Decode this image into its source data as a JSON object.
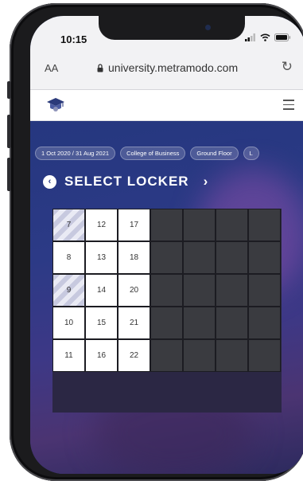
{
  "status_bar": {
    "time": "10:15"
  },
  "browser": {
    "text_size_label": "AA",
    "url": "university.metramodo.com"
  },
  "filters": [
    {
      "label": "1 Oct 2020 / 31 Aug 2021"
    },
    {
      "label": "College of Business"
    },
    {
      "label": "Ground Floor"
    },
    {
      "label": "L"
    }
  ],
  "page": {
    "title": "SELECT LOCKER"
  },
  "locker_grid": {
    "rows": [
      [
        {
          "label": "7",
          "state": "striped"
        },
        {
          "label": "12",
          "state": "available"
        },
        {
          "label": "17",
          "state": "available"
        },
        {
          "label": "",
          "state": "unavailable"
        },
        {
          "label": "",
          "state": "unavailable"
        },
        {
          "label": "",
          "state": "unavailable"
        },
        {
          "label": "",
          "state": "unavailable"
        }
      ],
      [
        {
          "label": "8",
          "state": "available"
        },
        {
          "label": "13",
          "state": "available"
        },
        {
          "label": "18",
          "state": "available"
        },
        {
          "label": "",
          "state": "unavailable"
        },
        {
          "label": "",
          "state": "unavailable"
        },
        {
          "label": "",
          "state": "unavailable"
        },
        {
          "label": "",
          "state": "unavailable"
        }
      ],
      [
        {
          "label": "9",
          "state": "striped"
        },
        {
          "label": "14",
          "state": "available"
        },
        {
          "label": "20",
          "state": "available"
        },
        {
          "label": "",
          "state": "unavailable"
        },
        {
          "label": "",
          "state": "unavailable"
        },
        {
          "label": "",
          "state": "unavailable"
        },
        {
          "label": "",
          "state": "unavailable"
        }
      ],
      [
        {
          "label": "10",
          "state": "available"
        },
        {
          "label": "15",
          "state": "available"
        },
        {
          "label": "21",
          "state": "available"
        },
        {
          "label": "",
          "state": "unavailable"
        },
        {
          "label": "",
          "state": "unavailable"
        },
        {
          "label": "",
          "state": "unavailable"
        },
        {
          "label": "",
          "state": "unavailable"
        }
      ],
      [
        {
          "label": "11",
          "state": "available"
        },
        {
          "label": "16",
          "state": "available"
        },
        {
          "label": "22",
          "state": "available"
        },
        {
          "label": "",
          "state": "unavailable"
        },
        {
          "label": "",
          "state": "unavailable"
        },
        {
          "label": "",
          "state": "unavailable"
        },
        {
          "label": "",
          "state": "unavailable"
        }
      ]
    ]
  },
  "icons": {
    "back": "chevron-left-circle-icon",
    "next": "chevron-right-icon",
    "menu": "hamburger-menu-icon",
    "lock": "lock-icon",
    "reload": "reload-icon",
    "logo": "graduation-cap-logo"
  },
  "colors": {
    "background": "#263a86",
    "locker_available": "#ffffff",
    "locker_unavailable": "#3a3b40",
    "locker_striped": "#c7c9df"
  }
}
